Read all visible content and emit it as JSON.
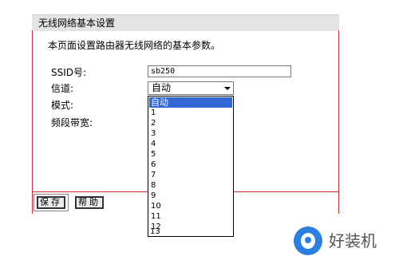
{
  "panel": {
    "title": "无线网络基本设置",
    "description": "本页面设置路由器无线网络的基本参数。"
  },
  "form": {
    "ssid_label": "SSID号:",
    "ssid_value": "sb250",
    "channel_label": "信道:",
    "channel_selected": "自动",
    "mode_label": "模式:",
    "bandwidth_label": "频段带宽:"
  },
  "channel_options": [
    "自动",
    "1",
    "2",
    "3",
    "4",
    "5",
    "6",
    "7",
    "8",
    "9",
    "10",
    "11",
    "12",
    "13"
  ],
  "buttons": {
    "save": "保存",
    "help": "帮助"
  },
  "watermark": {
    "site_text": "好装机"
  },
  "colors": {
    "accent_rule": "#d03030",
    "selection": "#3168d5",
    "logo": "#2a7fe0"
  }
}
